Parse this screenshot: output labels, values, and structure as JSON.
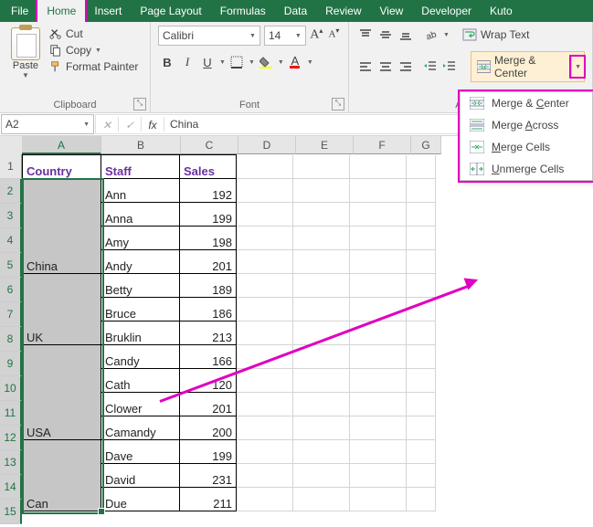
{
  "tabs": [
    "File",
    "Home",
    "Insert",
    "Page Layout",
    "Formulas",
    "Data",
    "Review",
    "View",
    "Developer",
    "Kuto"
  ],
  "active_tab": "Home",
  "clipboard": {
    "paste": "Paste",
    "cut": "Cut",
    "copy": "Copy",
    "format_painter": "Format Painter",
    "label": "Clipboard"
  },
  "font": {
    "name": "Calibri",
    "size": "14",
    "inc": "A",
    "dec": "A",
    "bold": "B",
    "italic": "I",
    "underline": "U",
    "fill_letter": "",
    "color_letter": "A",
    "label": "Font"
  },
  "alignment": {
    "wrap": "Wrap Text",
    "merge": "Merge & Center",
    "label": "Alignm"
  },
  "merge_menu": {
    "opt1": "Merge & Center",
    "opt2": "Merge Across",
    "opt3": "Merge Cells",
    "opt4": "Unmerge Cells"
  },
  "formula_bar": {
    "cell_ref": "A2",
    "value": "China"
  },
  "columns": {
    "A": 86,
    "B": 86,
    "C": 62,
    "D": 62,
    "E": 62,
    "F": 62,
    "G": 32
  },
  "rows": [
    "1",
    "2",
    "3",
    "4",
    "5",
    "6",
    "7",
    "8",
    "9",
    "10",
    "11",
    "12",
    "13",
    "14",
    "15"
  ],
  "headers": {
    "A": "Country",
    "B": "Staff",
    "C": "Sales"
  },
  "data": [
    {
      "country": "China",
      "span": 4,
      "staff": [
        "Ann",
        "Anna",
        "Amy",
        "Andy"
      ],
      "sales": [
        192,
        199,
        198,
        201
      ]
    },
    {
      "country": "UK",
      "span": 3,
      "staff": [
        "Betty",
        "Bruce",
        "Bruklin"
      ],
      "sales": [
        189,
        186,
        213
      ]
    },
    {
      "country": "USA",
      "span": 4,
      "staff": [
        "Candy",
        "Cath",
        "Clower",
        "Camandy"
      ],
      "sales": [
        166,
        120,
        201,
        200
      ]
    },
    {
      "country": "Can",
      "span": 3,
      "staff": [
        "Dave",
        "David",
        "Due"
      ],
      "sales": [
        199,
        231,
        211
      ]
    }
  ],
  "chart_data": {
    "type": "table",
    "columns": [
      "Country",
      "Staff",
      "Sales"
    ],
    "rows": [
      [
        "China",
        "Ann",
        192
      ],
      [
        "China",
        "Anna",
        199
      ],
      [
        "China",
        "Amy",
        198
      ],
      [
        "China",
        "Andy",
        201
      ],
      [
        "UK",
        "Betty",
        189
      ],
      [
        "UK",
        "Bruce",
        186
      ],
      [
        "UK",
        "Bruklin",
        213
      ],
      [
        "USA",
        "Candy",
        166
      ],
      [
        "USA",
        "Cath",
        120
      ],
      [
        "USA",
        "Clower",
        201
      ],
      [
        "USA",
        "Camandy",
        200
      ],
      [
        "Can",
        "Dave",
        199
      ],
      [
        "Can",
        "David",
        231
      ],
      [
        "Can",
        "Due",
        211
      ]
    ]
  }
}
